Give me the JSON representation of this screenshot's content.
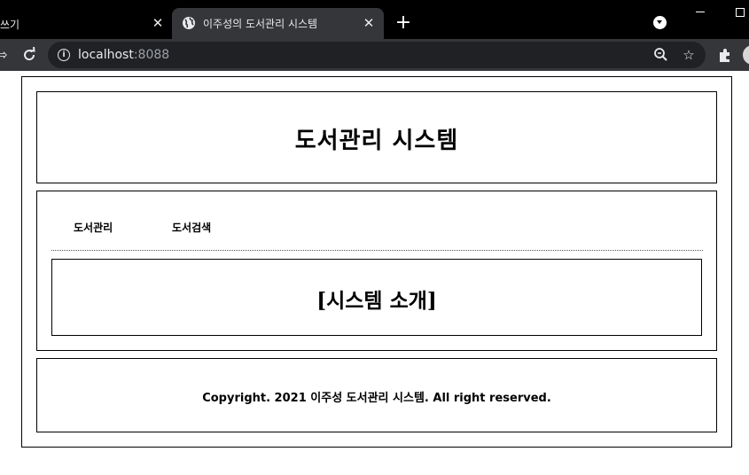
{
  "browser": {
    "tabs": [
      {
        "title": "쓰기",
        "active": false
      },
      {
        "title": "이주성의 도서관리 시스템",
        "active": true
      }
    ],
    "close_glyph": "✕",
    "new_tab_glyph": "+",
    "url_host": "localhost",
    "url_port": ":8088",
    "icons": [
      "back-icon",
      "reload-icon",
      "info-icon",
      "zoom-icon",
      "bookmark-star-icon",
      "extensions-icon",
      "profile-avatar"
    ],
    "colors": {
      "tab_bar": "#000000",
      "toolbar": "#35363a",
      "omnibox": "#202124"
    }
  },
  "page": {
    "header_title": "도서관리 시스템",
    "menu": [
      {
        "label": "도서관리"
      },
      {
        "label": "도서검색"
      }
    ],
    "intro_title": "[시스템 소개]",
    "footer_text": "Copyright. 2021 이주성 도서관리 시스템. All right reserved."
  }
}
